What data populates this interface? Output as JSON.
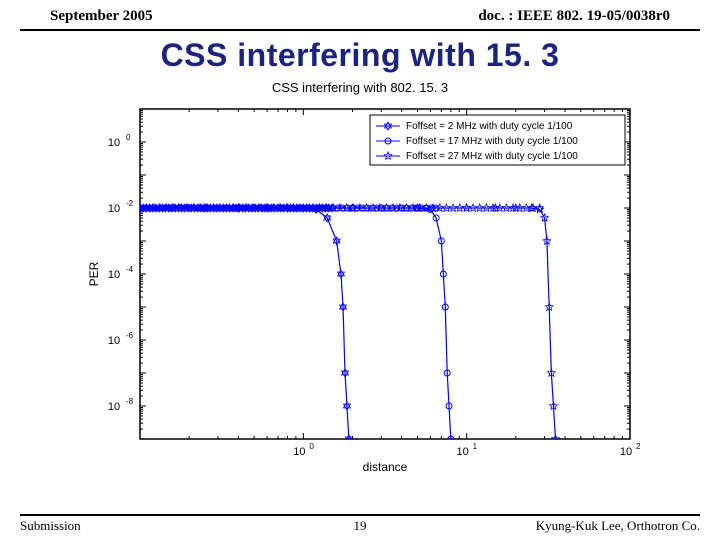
{
  "header": {
    "left": "September 2005",
    "right": "doc. : IEEE 802. 19-05/0038r0"
  },
  "title": "CSS interfering with 15. 3",
  "chart_data": {
    "type": "line",
    "title": "CSS interfering with 802. 15. 3",
    "xlabel": "distance",
    "ylabel": "PER",
    "xscale": "log",
    "yscale": "log",
    "xlim": [
      0.1,
      100
    ],
    "ylim": [
      1e-09,
      10
    ],
    "yticks": [
      1e-08,
      1e-06,
      0.0001,
      0.01,
      1
    ],
    "yticklabels": [
      "10^-8",
      "10^-6",
      "10^-4",
      "10^-2",
      "10^0"
    ],
    "xticks": [
      1,
      10,
      100
    ],
    "xticklabels": [
      "10^0",
      "10^1",
      "10^2"
    ],
    "legend": {
      "position": "upper right",
      "entries": [
        "Foffset = 2 MHz with duty cycle 1/100",
        "Foffset = 17 MHz with duty cycle 1/100",
        "Foffset = 27 MHz with duty cycle 1/100"
      ]
    },
    "series": [
      {
        "name": "Foffset = 2 MHz with duty cycle 1/100",
        "marker": "hexagram",
        "color": "#0000ff",
        "x": [
          0.1,
          0.25,
          0.4,
          0.6,
          0.8,
          1.0,
          1.2,
          1.4,
          1.6,
          1.7,
          1.75,
          1.8,
          1.85,
          1.9
        ],
        "y": [
          0.01,
          0.01,
          0.01,
          0.01,
          0.01,
          0.01,
          0.009,
          0.005,
          0.001,
          0.0001,
          1e-05,
          1e-07,
          1e-08,
          1e-09
        ]
      },
      {
        "name": "Foffset = 17 MHz with duty cycle 1/100",
        "marker": "circle",
        "color": "#0000ff",
        "x": [
          0.1,
          1,
          2,
          3,
          4,
          5,
          6,
          6.5,
          7,
          7.2,
          7.4,
          7.6,
          7.8,
          8
        ],
        "y": [
          0.01,
          0.01,
          0.01,
          0.01,
          0.01,
          0.01,
          0.009,
          0.005,
          0.001,
          0.0001,
          1e-05,
          1e-07,
          1e-08,
          1e-09
        ]
      },
      {
        "name": "Foffset = 27 MHz with duty cycle 1/100",
        "marker": "star",
        "color": "#0000ff",
        "x": [
          0.1,
          2,
          5,
          10,
          15,
          20,
          25,
          28,
          30,
          31,
          32,
          33,
          34,
          35
        ],
        "y": [
          0.01,
          0.01,
          0.01,
          0.01,
          0.01,
          0.01,
          0.01,
          0.009,
          0.005,
          0.001,
          1e-05,
          1e-07,
          1e-08,
          1e-09
        ]
      }
    ]
  },
  "footer": {
    "left": "Submission",
    "center": "19",
    "right": "Kyung-Kuk Lee, Orthotron Co."
  }
}
